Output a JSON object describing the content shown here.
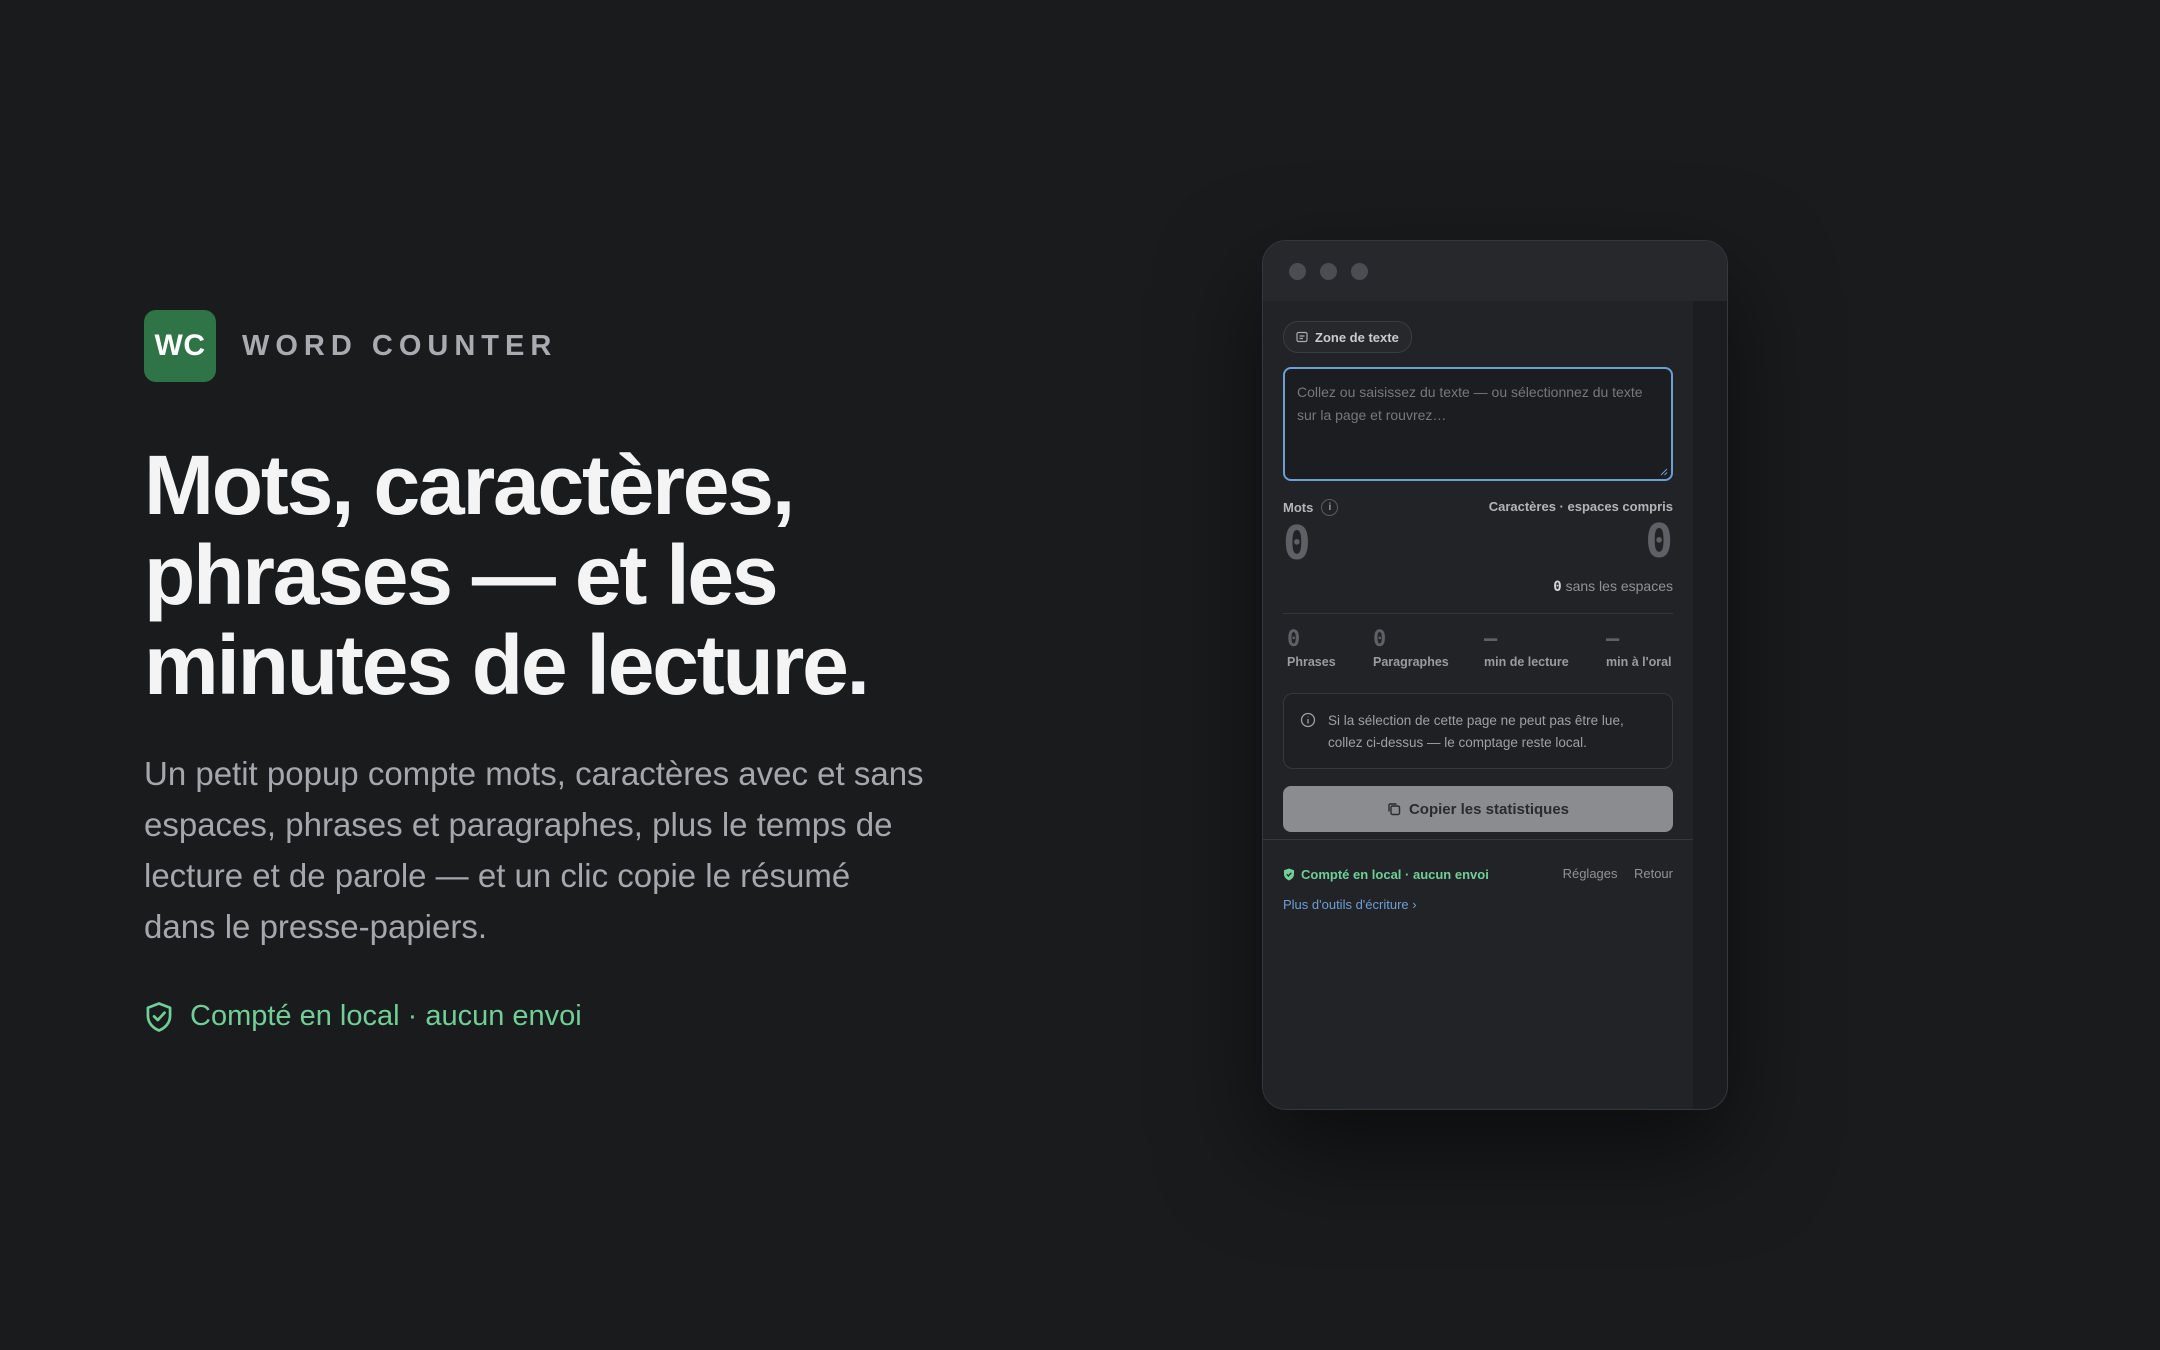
{
  "brand": {
    "logo_text": "WC",
    "name": "WORD COUNTER",
    "logo_color": "#2f7446"
  },
  "hero": {
    "headline": "Mots, caractères, phrases — et les minutes de lecture.",
    "lede": "Un petit popup compte mots, caractères avec et sans espaces, phrases et paragraphes, plus le temps de lecture et de parole — et un clic copie le résumé dans le presse-papiers.",
    "privacy": "Compté en local · aucun envoi",
    "privacy_icon": "shield-check-icon",
    "accent": "#6fcf97"
  },
  "popup": {
    "chip": "Zone de texte",
    "textarea_placeholder": "Collez ou saisissez du texte — ou sélectionnez du texte sur la page et rouvrez…",
    "words_label": "Mots",
    "info_glyph": "i",
    "words_value": "0",
    "chars_label": "Caractères · espaces compris",
    "chars_value": "0",
    "no_spaces_value": "0",
    "no_spaces_label": "sans les espaces",
    "stats": [
      {
        "value": "0",
        "label": "Phrases"
      },
      {
        "value": "0",
        "label": "Paragraphes"
      },
      {
        "value": "—",
        "label": "min de lecture"
      },
      {
        "value": "—",
        "label": "min à l'oral"
      }
    ],
    "notice": "Si la sélection de cette page ne peut pas être lue, collez ci-dessus — le comptage reste local.",
    "copy_button": "Copier les statistiques",
    "footer_privacy": "Compté en local · aucun envoi",
    "settings": "Réglages",
    "back": "Retour",
    "more_tools": "Plus d'outils d'écriture ›",
    "focus_color": "#6b9fd6"
  }
}
